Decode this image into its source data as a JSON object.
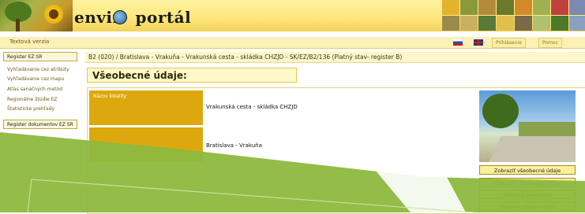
{
  "header": {
    "logo_text_pre": "envir",
    "logo_text_post": "portál"
  },
  "topnav": {
    "text_version": "Textová verzia",
    "login": "Prihlásenie",
    "help": "Pomoc"
  },
  "sidebar": {
    "registry_box": "Register EZ SR",
    "links": [
      "Vyhľadávanie cez atribúty",
      "Vyhľadávanie cez mapu",
      "Atlas sanačných metód",
      "Regionálne štúdie EZ",
      "Štatistické prehľady"
    ],
    "documents_box": "Register dokumentov EZ SR"
  },
  "main": {
    "breadcrumb": "B2 (020) / Bratislava - Vrakuňa - Vrakunská cesta - skládka CHZJD - SK/EZ/B2/136 (Platný stav- register B)",
    "section_title": "Všeobecné údaje:",
    "rows": [
      {
        "label": "Názov lokality",
        "value": "Vrakunská cesta - skládka CHZJD"
      },
      {
        "label": "",
        "value": "Bratislava - Vrakuňa"
      }
    ],
    "buttons": [
      "Zobraziť všeobecné údaje",
      "Zobraziť obrazové prílohy",
      "Zobraziť anotátora",
      "Register dokumentov"
    ]
  },
  "colors": {
    "accent_gold": "#dda80e",
    "header_yellow": "#fde67a",
    "overlay_green": "#8db83f"
  }
}
